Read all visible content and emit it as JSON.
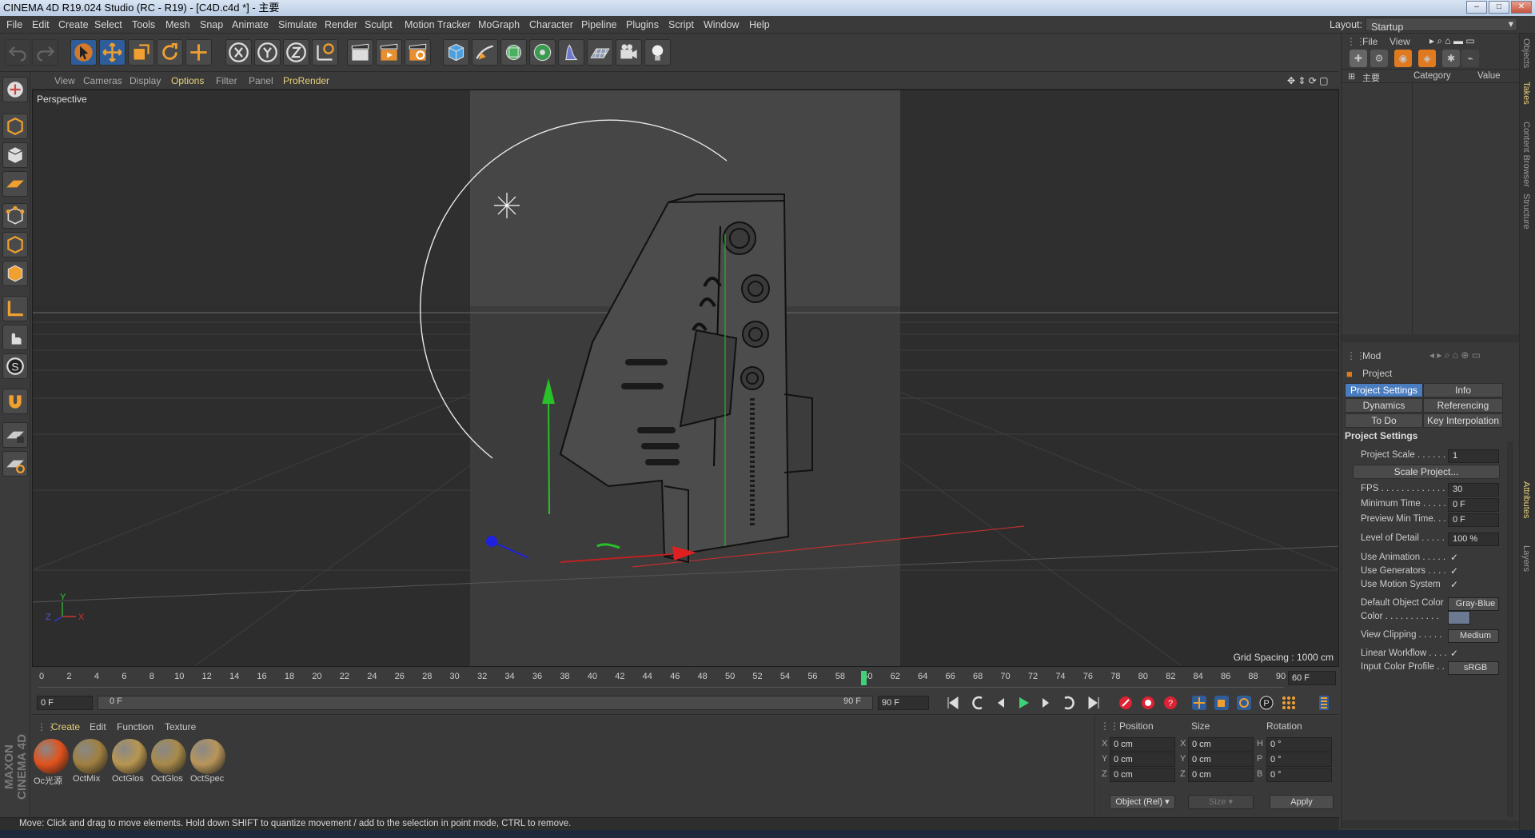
{
  "window": {
    "title": "CINEMA 4D R19.024 Studio (RC - R19) - [C4D.c4d *] - 主要"
  },
  "menu": {
    "items": [
      "File",
      "Edit",
      "Create",
      "Select",
      "Tools",
      "Mesh",
      "Snap",
      "Animate",
      "Simulate",
      "Render",
      "Sculpt",
      "Motion Tracker",
      "MoGraph",
      "Character",
      "Pipeline",
      "Plugins",
      "Script",
      "Window",
      "Help"
    ],
    "layout_label": "Layout:",
    "layout_value": "Startup"
  },
  "viewport": {
    "menu": [
      "View",
      "Cameras",
      "Display",
      "Options",
      "Filter",
      "Panel",
      "ProRender"
    ],
    "camera_label": "Perspective",
    "grid_spacing": "Grid Spacing : 1000 cm"
  },
  "timeline": {
    "ticks": [
      "0",
      "2",
      "4",
      "6",
      "8",
      "10",
      "12",
      "14",
      "16",
      "18",
      "20",
      "22",
      "24",
      "26",
      "28",
      "30",
      "32",
      "34",
      "36",
      "38",
      "40",
      "42",
      "44",
      "46",
      "48",
      "50",
      "52",
      "54",
      "56",
      "58",
      "60",
      "62",
      "64",
      "66",
      "68",
      "70",
      "72",
      "74",
      "76",
      "78",
      "80",
      "82",
      "84",
      "86",
      "88",
      "90"
    ],
    "current_frame": 60,
    "end_field": "60 F",
    "start_field": "0 F",
    "range_start": "0 F",
    "range_end": "90 F",
    "max_field": "90 F"
  },
  "materials": {
    "menu": [
      "Create",
      "Edit",
      "Function",
      "Texture"
    ],
    "items": [
      {
        "name": "Oc光源",
        "color": "#e2521c"
      },
      {
        "name": "OctMix",
        "color": "#a08040"
      },
      {
        "name": "OctGlos",
        "color": "#b89650"
      },
      {
        "name": "OctGlos",
        "color": "#a88a4a"
      },
      {
        "name": "OctSpec",
        "color": "#b8955a"
      }
    ]
  },
  "coords": {
    "headers": [
      "Position",
      "Size",
      "Rotation"
    ],
    "rows": [
      {
        "a": "X",
        "pos": "0 cm",
        "b": "X",
        "size": "0 cm",
        "c": "H",
        "rot": "0 °"
      },
      {
        "a": "Y",
        "pos": "0 cm",
        "b": "Y",
        "size": "0 cm",
        "c": "P",
        "rot": "0 °"
      },
      {
        "a": "Z",
        "pos": "0 cm",
        "b": "Z",
        "size": "0 cm",
        "c": "B",
        "rot": "0 °"
      }
    ],
    "mode": "Object (Rel)",
    "size_mode": "Size",
    "apply": "Apply"
  },
  "status": "Move: Click and drag to move elements. Hold down SHIFT to quantize movement / add to the selection in point mode, CTRL to remove.",
  "brand": "MAXON CINEMA 4D",
  "objects_panel": {
    "menu": [
      "File",
      "View"
    ],
    "col_name": "主要",
    "col_category": "Category",
    "col_value": "Value"
  },
  "attributes": {
    "menu": "Mod",
    "title": "Project",
    "tabs": [
      "Project Settings",
      "Info",
      "Dynamics",
      "Referencing",
      "To Do",
      "Key Interpolation"
    ],
    "section": "Project Settings",
    "fields": [
      {
        "label": "Project Scale . . . . . .",
        "value": "1"
      },
      {
        "label": "Scale Project...",
        "value": ""
      },
      {
        "label": "FPS . . . . . . . . . . . . . .",
        "value": "30"
      },
      {
        "label": "Minimum Time . . . . .",
        "value": "0 F"
      },
      {
        "label": "Preview Min Time. . .",
        "value": "0 F"
      },
      {
        "label": "Level of Detail . . . . .",
        "value": "100 %"
      },
      {
        "label": "Use Animation . . . . .",
        "value": "✓"
      },
      {
        "label": "Use Generators . . . .",
        "value": "✓"
      },
      {
        "label": "Use Motion System",
        "value": "✓"
      },
      {
        "label": "Default Object Color",
        "value": "Gray-Blue"
      },
      {
        "label": "Color . . . . . . . . . . .",
        "value": ""
      },
      {
        "label": "View Clipping . . . . .",
        "value": "Medium"
      },
      {
        "label": "Linear Workflow . . . .",
        "value": "✓"
      },
      {
        "label": "Input Color Profile . .",
        "value": "sRGB"
      }
    ]
  },
  "right_tabs": [
    "Objects",
    "Takes",
    "Content Browser",
    "Structure",
    "Attributes",
    "Layers"
  ]
}
